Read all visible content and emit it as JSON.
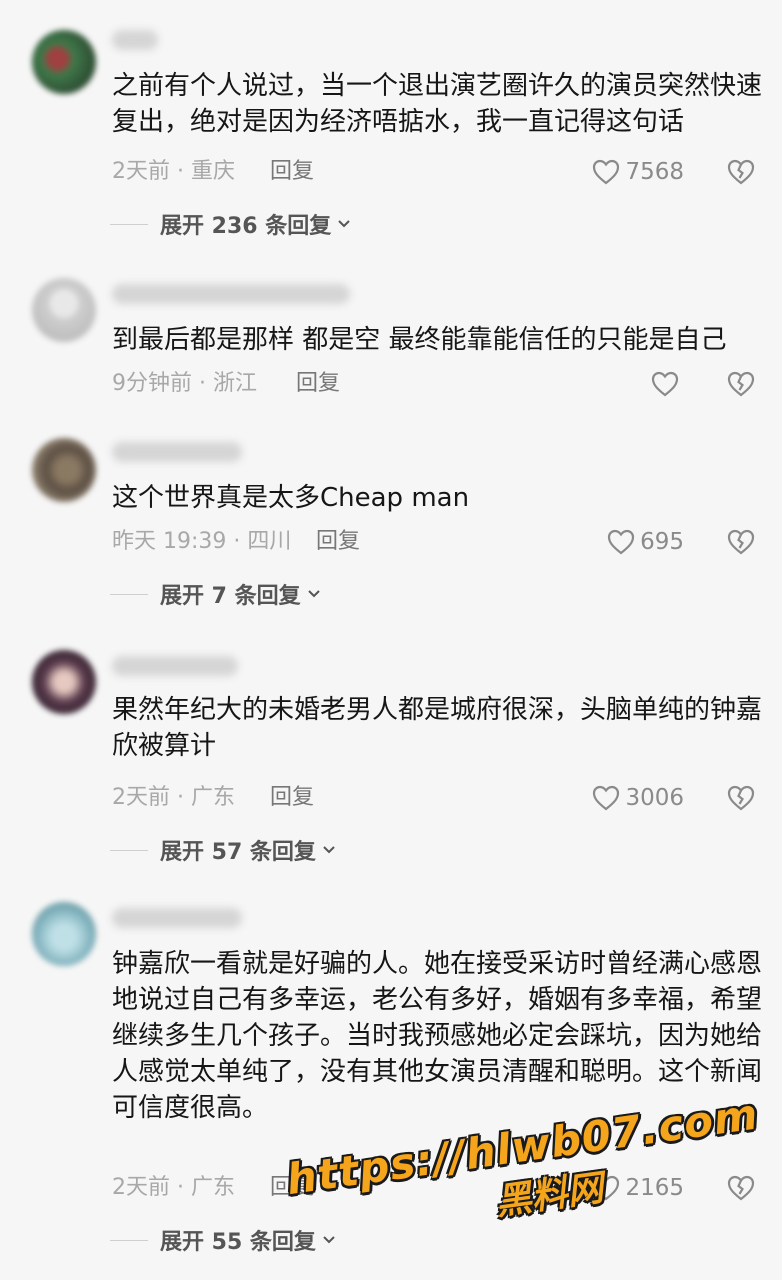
{
  "comments": [
    {
      "text": "之前有个人说过，当一个退出演艺圈许久的演员突然快速复出，绝对是因为经济唔掂水，我一直记得这句话",
      "meta": "2天前 · 重庆",
      "reply": "回复",
      "likes": "7568",
      "expand": "展开 236 条回复"
    },
    {
      "text": "到最后都是那样 都是空 最终能靠能信任的只能是自己",
      "meta": "9分钟前 · 浙江",
      "reply": "回复",
      "likes": ""
    },
    {
      "text": "这个世界真是太多Cheap man",
      "meta": "昨天 19:39 · 四川",
      "reply": "回复",
      "likes": "695",
      "expand": "展开 7 条回复"
    },
    {
      "text": "果然年纪大的未婚老男人都是城府很深，头脑单纯的钟嘉欣被算计",
      "meta": "2天前 · 广东",
      "reply": "回复",
      "likes": "3006",
      "expand": "展开 57 条回复"
    },
    {
      "text": "钟嘉欣一看就是好骗的人。她在接受采访时曾经满心感恩地说过自己有多幸运，老公有多好，婚姻有多幸福，希望继续多生几个孩子。当时我预感她必定会踩坑，因为她给人感觉太单纯了，没有其他女演员清醒和聪明。这个新闻可信度很高。",
      "meta": "2天前 · 广东",
      "reply": "回复",
      "likes": "2165",
      "expand": "展开 55 条回复"
    }
  ],
  "watermark": {
    "url": "https://hlwb07.com",
    "brand": "黑料网"
  },
  "icons": {
    "like": "heart-outline-icon",
    "dislike": "broken-heart-icon",
    "expand": "chevron-down-icon"
  },
  "colors": {
    "background": "#f6f6f6",
    "text": "#161616",
    "meta": "#a8a8a8",
    "watermark": "#f4a51c"
  }
}
